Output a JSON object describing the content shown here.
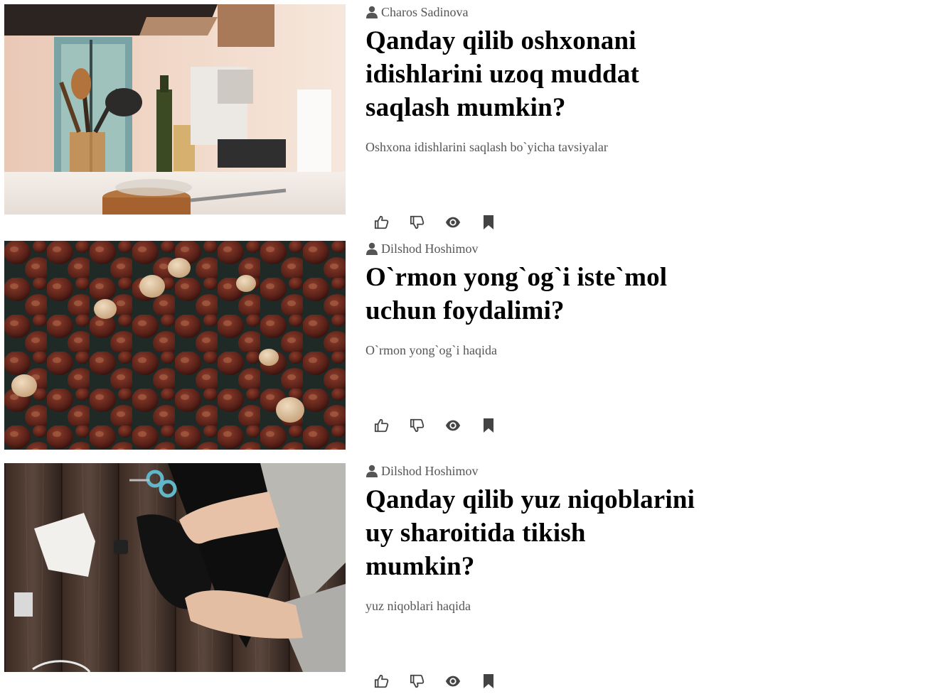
{
  "articles": [
    {
      "author": "Charos Sadinova",
      "title": "Qanday qilib oshxonani idishlarini uzoq muddat saqlash mumkin?",
      "description": "Oshxona idishlarini saqlash bo`yicha tavsiyalar",
      "image": "kitchen-utensils-photo"
    },
    {
      "author": "Dilshod Hoshimov",
      "title": "O`rmon yong`og`i iste`mol uchun foydalimi?",
      "description": "O`rmon yong`og`i haqida",
      "image": "hazelnuts-photo"
    },
    {
      "author": "Dilshod Hoshimov",
      "title": "Qanday qilib yuz niqoblarini uy sharoitida tikish mumkin?",
      "description": "yuz niqoblari haqida",
      "image": "sewing-masks-photo"
    }
  ],
  "action_icons": [
    "thumbs-up-icon",
    "thumbs-down-icon",
    "eye-icon",
    "bookmark-icon"
  ],
  "colors": {
    "text": "#000000",
    "muted": "#555555",
    "icon": "#444444"
  }
}
